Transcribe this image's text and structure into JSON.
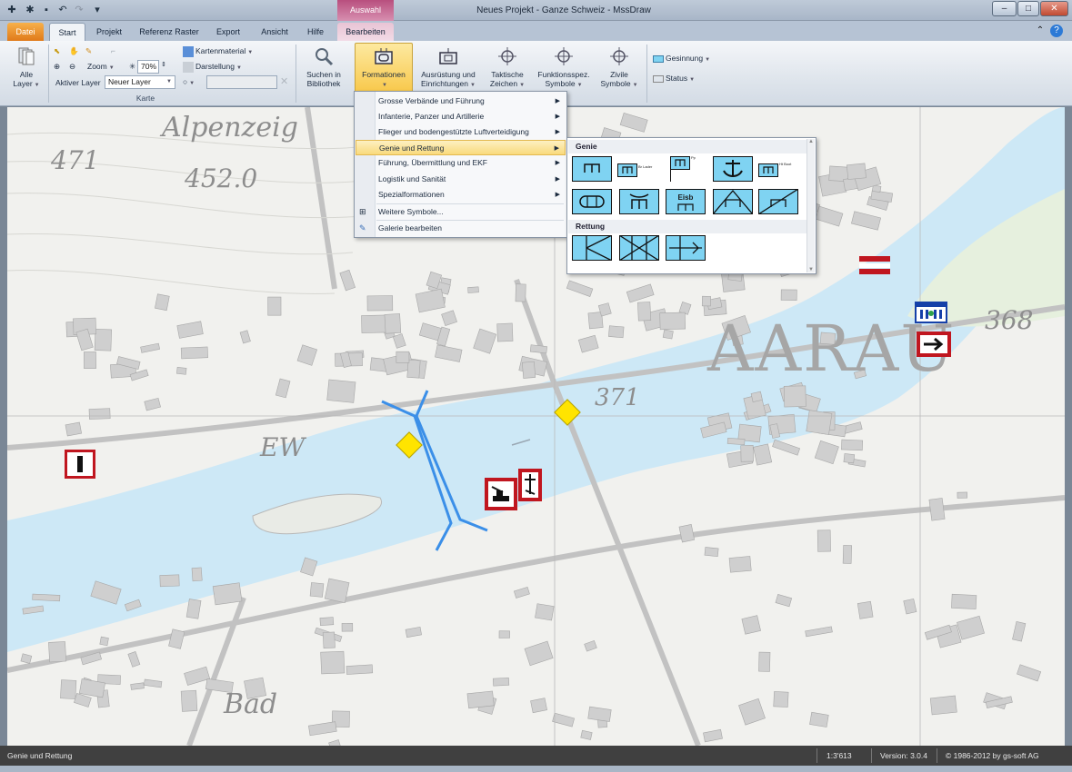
{
  "window": {
    "title": "Neues Projekt - Ganze Schweiz - MssDraw",
    "context_tab_header": "Auswahl",
    "minimize": "–",
    "maximize": "□",
    "close": "✕"
  },
  "tabs": {
    "datei": "Datei",
    "start": "Start",
    "projekt": "Projekt",
    "referenz_raster": "Referenz Raster",
    "export": "Export",
    "ansicht": "Ansicht",
    "hilfe": "Hilfe",
    "bearbeiten": "Bearbeiten"
  },
  "ribbon": {
    "alle_layer": [
      "Alle",
      "Layer"
    ],
    "zoom_label": "Zoom",
    "zoom_value": "70%",
    "aktiver_layer_label": "Aktiver Layer",
    "aktiver_layer_value": "Neuer Layer",
    "kartenmaterial": "Kartenmaterial",
    "darstellung": "Darstellung",
    "group_karte": "Karte",
    "suchen": [
      "Suchen in",
      "Bibliothek"
    ],
    "formationen": "Formationen",
    "ausruestung": [
      "Ausrüstung und",
      "Einrichtungen"
    ],
    "taktische": [
      "Taktische",
      "Zeichen"
    ],
    "funktionsspez": [
      "Funktionsspez.",
      "Symbole"
    ],
    "zivile": [
      "Zivile",
      "Symbole"
    ],
    "gesinnung": "Gesinnung",
    "status": "Status"
  },
  "menu": {
    "items": [
      "Grosse Verbände und Führung",
      "Infanterie, Panzer und Artillerie",
      "Flieger und bodengestützte Luftverteidigung",
      "Genie und Rettung",
      "Führung, Übermittlung und EKF",
      "Logistik und Sanität",
      "Spezialformationen"
    ],
    "weitere": "Weitere Symbole...",
    "galerie": "Galerie bearbeiten",
    "highlighted": "Genie und Rettung"
  },
  "gallery": {
    "genie_header": "Genie",
    "rettung_header": "Rettung",
    "eisb_label": "Eisb",
    "small_labels": [
      "Br Lader",
      "Pp",
      "Ht Boot"
    ]
  },
  "map": {
    "labels": [
      "Alpenzeig",
      "471",
      "452.0",
      "EW",
      "371",
      "AARAU",
      "368",
      "Bad"
    ]
  },
  "statusbar": {
    "text": "Genie und Rettung",
    "scale": "1:3'613",
    "version": "Version: 3.0.4",
    "copyright": "© 1986-2012 by gs-soft AG"
  },
  "colors": {
    "river": "#cde8f6",
    "route": "#3b8fe8",
    "symbol_red": "#c0161f",
    "symbol_fill": "#7fd3f2",
    "highlight": "#f9da7c"
  }
}
